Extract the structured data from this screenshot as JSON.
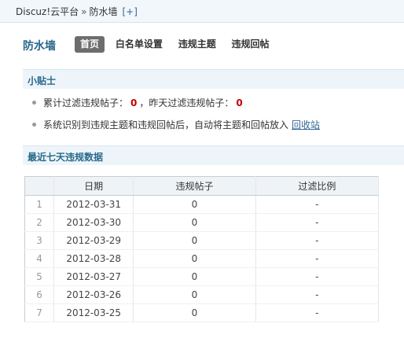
{
  "breadcrumb": {
    "root": "Discuz!云平台",
    "separator": "»",
    "current": "防水墙",
    "add_label": "[+]"
  },
  "header": {
    "title": "防水墙",
    "tabs": [
      {
        "label": "首页",
        "active": true
      },
      {
        "label": "白名单设置",
        "active": false
      },
      {
        "label": "违规主题",
        "active": false
      },
      {
        "label": "违规回帖",
        "active": false
      }
    ]
  },
  "tips": {
    "heading": "小贴士",
    "line1_prefix": "累计过滤违规帖子：",
    "total_filtered": "0",
    "line1_middle": "，昨天过滤违规帖子：",
    "yesterday_filtered": "0",
    "line2_text": "系统识别到违规主题和违规回帖后，自动将主题和回帖放入",
    "line2_link": "回收站"
  },
  "stats": {
    "heading": "最近七天违规数据",
    "columns": [
      "",
      "日期",
      "违规帖子",
      "过滤比例"
    ],
    "rows": [
      {
        "index": "1",
        "date": "2012-03-31",
        "count": "0",
        "ratio": "-"
      },
      {
        "index": "2",
        "date": "2012-03-30",
        "count": "0",
        "ratio": "-"
      },
      {
        "index": "3",
        "date": "2012-03-29",
        "count": "0",
        "ratio": "-"
      },
      {
        "index": "4",
        "date": "2012-03-28",
        "count": "0",
        "ratio": "-"
      },
      {
        "index": "5",
        "date": "2012-03-27",
        "count": "0",
        "ratio": "-"
      },
      {
        "index": "6",
        "date": "2012-03-26",
        "count": "0",
        "ratio": "-"
      },
      {
        "index": "7",
        "date": "2012-03-25",
        "count": "0",
        "ratio": "-"
      }
    ]
  },
  "colors": {
    "accent": "#27698b",
    "alert": "#c00000",
    "active_tab": "#6d6d6d"
  }
}
